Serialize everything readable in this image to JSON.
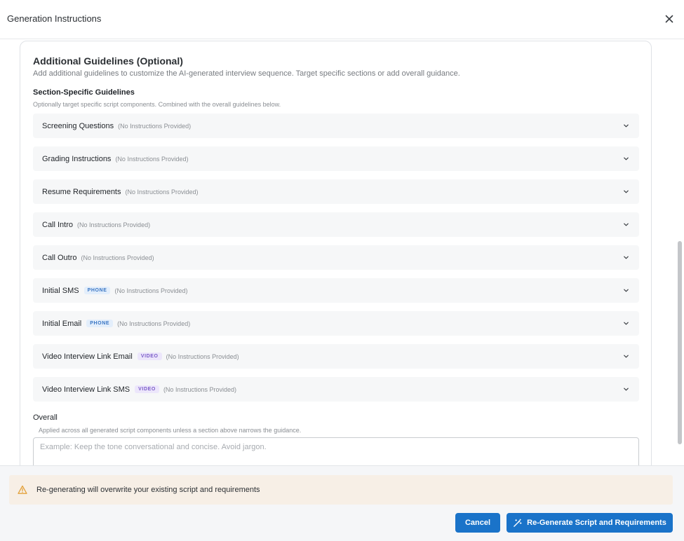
{
  "header": {
    "title": "Generation Instructions"
  },
  "card": {
    "title": "Additional Guidelines (Optional)",
    "description": "Add additional guidelines to customize the AI-generated interview sequence. Target specific sections or add overall guidance.",
    "section_title": "Section-Specific Guidelines",
    "section_description": "Optionally target specific script components. Combined with the overall guidelines below."
  },
  "sections": [
    {
      "label": "Screening Questions",
      "badge": "",
      "badge_type": "",
      "status": "(No Instructions Provided)"
    },
    {
      "label": "Grading Instructions",
      "badge": "",
      "badge_type": "",
      "status": "(No Instructions Provided)"
    },
    {
      "label": "Resume Requirements",
      "badge": "",
      "badge_type": "",
      "status": "(No Instructions Provided)"
    },
    {
      "label": "Call Intro",
      "badge": "",
      "badge_type": "",
      "status": "(No Instructions Provided)"
    },
    {
      "label": "Call Outro",
      "badge": "",
      "badge_type": "",
      "status": "(No Instructions Provided)"
    },
    {
      "label": "Initial SMS",
      "badge": "PHONE",
      "badge_type": "phone",
      "status": "(No Instructions Provided)"
    },
    {
      "label": "Initial Email",
      "badge": "PHONE",
      "badge_type": "phone",
      "status": "(No Instructions Provided)"
    },
    {
      "label": "Video Interview Link Email",
      "badge": "VIDEO",
      "badge_type": "video",
      "status": "(No Instructions Provided)"
    },
    {
      "label": "Video Interview Link SMS",
      "badge": "VIDEO",
      "badge_type": "video",
      "status": "(No Instructions Provided)"
    }
  ],
  "overall": {
    "label": "Overall",
    "help": "Applied across all generated script components unless a section above narrows the guidance.",
    "placeholder": "Example: Keep the tone conversational and concise. Avoid jargon.",
    "value": ""
  },
  "footer": {
    "warning": "Re-generating will overwrite your existing script and requirements",
    "cancel_label": "Cancel",
    "regenerate_label": "Re-Generate Script and Requirements"
  },
  "icons": {
    "close": "close-icon",
    "chevron": "chevron-down-icon",
    "warning": "warning-icon",
    "regenerate": "magic-wand-icon"
  },
  "colors": {
    "primary": "#1a73c9",
    "warning_bg": "#f7efe6",
    "warning_icon": "#e3a23c",
    "phone_badge_bg": "#e3eefb",
    "phone_badge_text": "#3a76c4",
    "video_badge_bg": "#ece6fb",
    "video_badge_text": "#7a5bc8"
  }
}
